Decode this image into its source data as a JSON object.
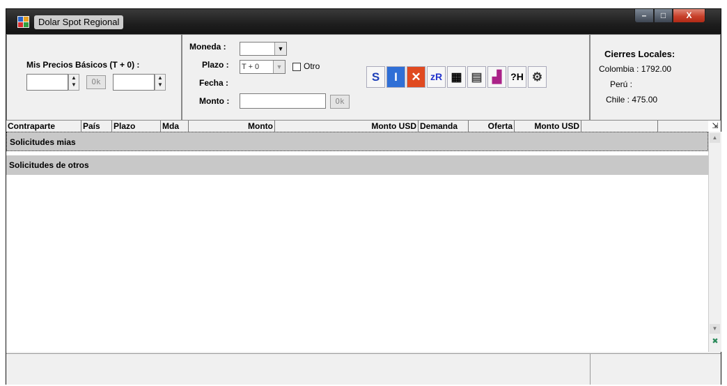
{
  "window": {
    "title": "Dolar Spot Regional",
    "controls": {
      "minimize": "–",
      "maximize": "□",
      "close": "X"
    }
  },
  "precios": {
    "label": "Mis Precios Básicos (T + 0) :",
    "field1_value": "",
    "field2_value": "",
    "ok_label": "Ok"
  },
  "form": {
    "moneda_label": "Moneda :",
    "moneda_value": "",
    "plazo_label": "Plazo :",
    "plazo_value": "T + 0",
    "otro_label": "Otro",
    "fecha_label": "Fecha :",
    "fecha_value": "",
    "monto_label": "Monto :",
    "monto_value": "",
    "ok_label": "Ok"
  },
  "toolbar": [
    {
      "name": "tool-s-icon",
      "glyph": "S",
      "color": "#1d3fb8"
    },
    {
      "name": "tool-info-icon",
      "glyph": "I",
      "color": "#ffffff",
      "bg": "#2f6fd6"
    },
    {
      "name": "tool-delete-icon",
      "glyph": "✕",
      "color": "#ffffff",
      "bg": "#e04a20"
    },
    {
      "name": "tool-zr-icon",
      "glyph": "zR",
      "color": "#2233cc"
    },
    {
      "name": "tool-cupos-icon",
      "glyph": "▦",
      "color": "#000000"
    },
    {
      "name": "tool-book-icon",
      "glyph": "▤",
      "color": "#444444"
    },
    {
      "name": "tool-chart-icon",
      "glyph": "▟",
      "color": "#aa2288"
    },
    {
      "name": "tool-history-icon",
      "glyph": "?H",
      "color": "#111111"
    },
    {
      "name": "tool-settings-icon",
      "glyph": "⚙",
      "color": "#333333"
    }
  ],
  "cierres": {
    "title": "Cierres Locales:",
    "colombia": "Colombia : 1792.00",
    "peru": "Perú :",
    "chile": "Chile : 475.00"
  },
  "grid": {
    "columns": [
      "Contraparte",
      "País",
      "Plazo",
      "Mda",
      "Monto",
      "Monto USD",
      "Demanda",
      "Oferta",
      "Monto USD"
    ],
    "groups": [
      "Solicitudes mias",
      "Solicitudes de otros"
    ]
  },
  "colors": {
    "titlebar": "#1e1e1e",
    "window_bg": "#f0f0f0",
    "group_bg": "#c8c8c8",
    "close_btn": "#c8402b"
  },
  "statusbar": {
    "left": "",
    "right": ""
  }
}
